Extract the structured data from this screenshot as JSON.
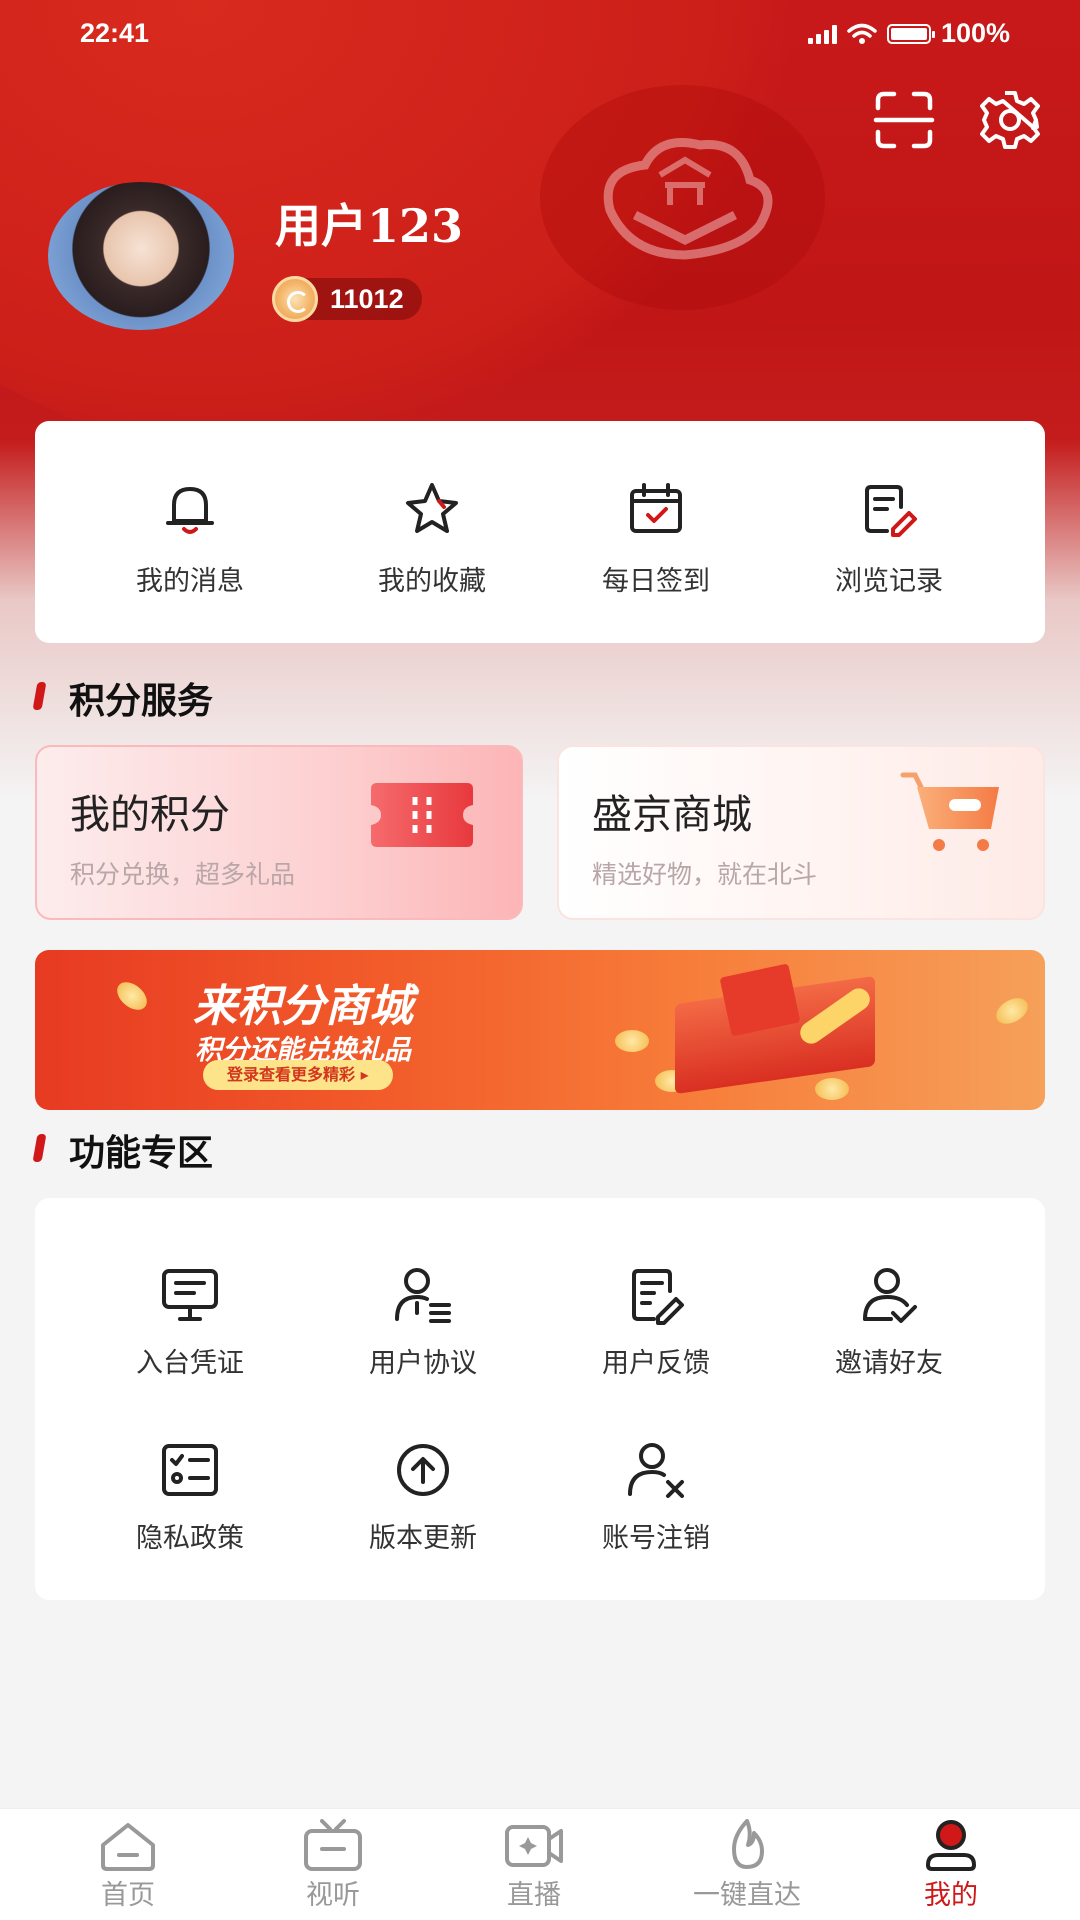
{
  "status_bar": {
    "time": "22:41",
    "battery": "100%"
  },
  "profile": {
    "username": "用户123",
    "points": "11012"
  },
  "quick_actions": [
    {
      "label": "我的消息",
      "icon": "bell-icon"
    },
    {
      "label": "我的收藏",
      "icon": "star-icon"
    },
    {
      "label": "每日签到",
      "icon": "calendar-check-icon"
    },
    {
      "label": "浏览记录",
      "icon": "history-edit-icon"
    }
  ],
  "sections": {
    "points_service": "积分服务",
    "features": "功能专区"
  },
  "services": [
    {
      "title": "我的积分",
      "subtitle": "积分兑换，超多礼品",
      "icon": "ticket-icon"
    },
    {
      "title": "盛京商城",
      "subtitle": "精选好物，就在北斗",
      "icon": "shopping-cart-icon"
    }
  ],
  "banner": {
    "title": "来积分商城",
    "subtitle": "积分还能兑换礼品",
    "button": "登录查看更多精彩"
  },
  "features": [
    {
      "label": "入台凭证",
      "icon": "monitor-icon"
    },
    {
      "label": "用户协议",
      "icon": "user-agreement-icon"
    },
    {
      "label": "用户反馈",
      "icon": "feedback-icon"
    },
    {
      "label": "邀请好友",
      "icon": "invite-user-icon"
    },
    {
      "label": "隐私政策",
      "icon": "privacy-list-icon"
    },
    {
      "label": "版本更新",
      "icon": "upload-circle-icon"
    },
    {
      "label": "账号注销",
      "icon": "user-remove-icon"
    }
  ],
  "tabs": [
    {
      "label": "首页",
      "icon": "home-icon",
      "active": false
    },
    {
      "label": "视听",
      "icon": "tv-icon",
      "active": false
    },
    {
      "label": "直播",
      "icon": "video-camera-icon",
      "active": false
    },
    {
      "label": "一键直达",
      "icon": "flame-icon",
      "active": false
    },
    {
      "label": "我的",
      "icon": "profile-icon",
      "active": true
    }
  ],
  "colors": {
    "brand_red": "#d01818",
    "header_red": "#c41a1a",
    "inactive_gray": "#999999"
  }
}
